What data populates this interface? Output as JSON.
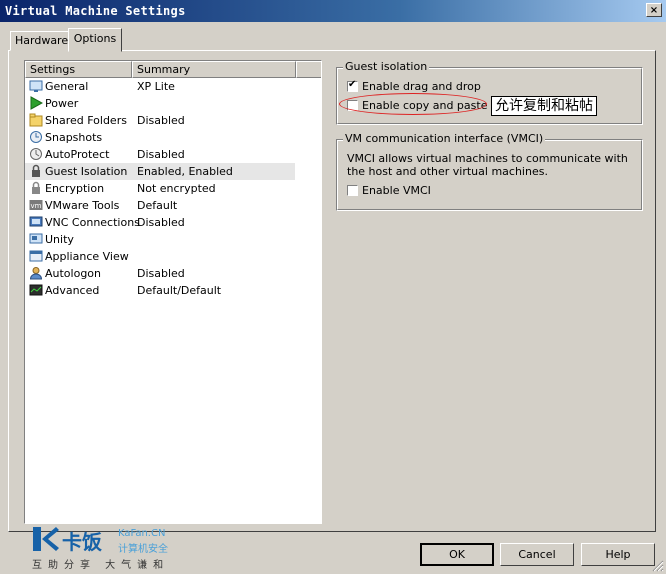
{
  "window": {
    "title": "Virtual Machine Settings",
    "close_glyph": "×"
  },
  "tabs": [
    {
      "label": "Hardware",
      "active": false
    },
    {
      "label": "Options",
      "active": true
    }
  ],
  "settings_list": {
    "columns": [
      "Settings",
      "Summary"
    ],
    "rows": [
      {
        "name": "General",
        "summary": "XP Lite",
        "icon": "general-icon"
      },
      {
        "name": "Power",
        "summary": "",
        "icon": "power-icon"
      },
      {
        "name": "Shared Folders",
        "summary": "Disabled",
        "icon": "shared-folders-icon"
      },
      {
        "name": "Snapshots",
        "summary": "",
        "icon": "snapshots-icon"
      },
      {
        "name": "AutoProtect",
        "summary": "Disabled",
        "icon": "autoprotect-icon"
      },
      {
        "name": "Guest Isolation",
        "summary": "Enabled, Enabled",
        "icon": "guest-isolation-icon",
        "selected": true
      },
      {
        "name": "Encryption",
        "summary": "Not encrypted",
        "icon": "encryption-icon"
      },
      {
        "name": "VMware Tools",
        "summary": "Default",
        "icon": "vmware-tools-icon"
      },
      {
        "name": "VNC Connections",
        "summary": "Disabled",
        "icon": "vnc-icon"
      },
      {
        "name": "Unity",
        "summary": "",
        "icon": "unity-icon"
      },
      {
        "name": "Appliance View",
        "summary": "",
        "icon": "appliance-view-icon"
      },
      {
        "name": "Autologon",
        "summary": "Disabled",
        "icon": "autologon-icon"
      },
      {
        "name": "Advanced",
        "summary": "Default/Default",
        "icon": "advanced-icon"
      }
    ]
  },
  "guest_isolation": {
    "legend": "Guest isolation",
    "drag_drop": {
      "label": "Enable drag and drop",
      "checked": true
    },
    "copy_paste": {
      "label": "Enable copy and paste",
      "checked": false
    }
  },
  "annotation": {
    "note": "允许复制和粘帖",
    "color": "#dd2222"
  },
  "vmci": {
    "legend": "VM communication interface (VMCI)",
    "description": "VMCI allows virtual machines to communicate with the host and other virtual machines.",
    "enable": {
      "label": "Enable VMCI",
      "checked": false
    }
  },
  "buttons": {
    "ok": "OK",
    "cancel": "Cancel",
    "help": "Help"
  },
  "watermark": {
    "brand_cn": "卡饭",
    "url": "KaFan.CN",
    "subtitle": "计算机安全",
    "slogan": "互助分享 大气谦和",
    "color": "#1762a8"
  }
}
